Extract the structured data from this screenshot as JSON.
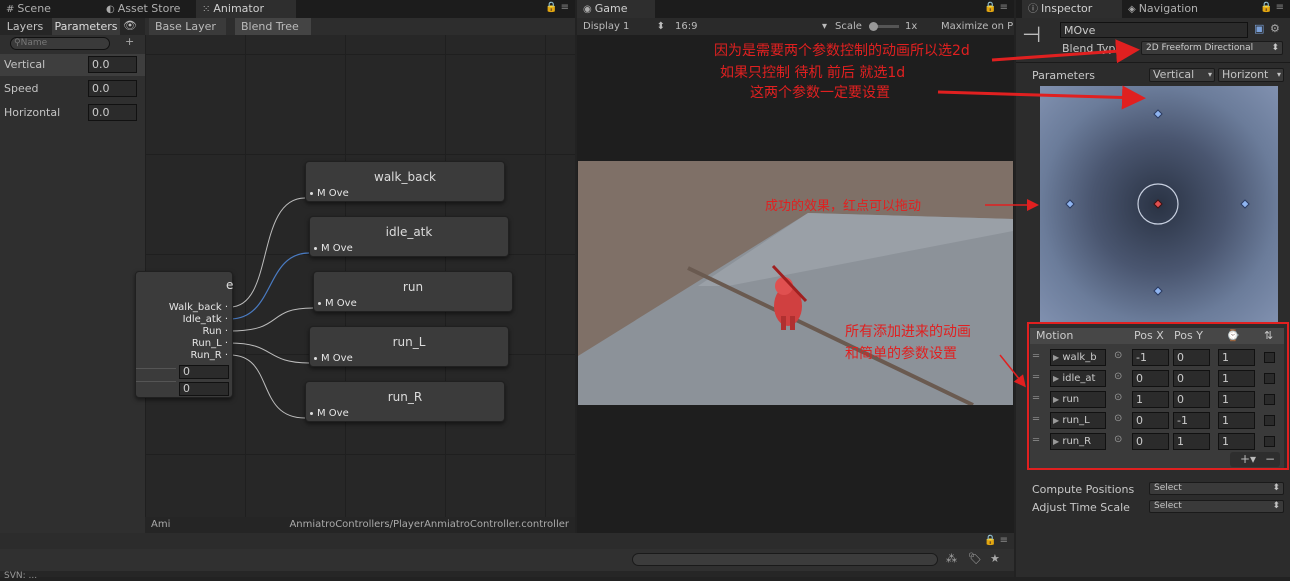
{
  "tabs": {
    "scene": "Scene",
    "asset_store": "Asset Store",
    "animator": "Animator",
    "game": "Game",
    "inspector": "Inspector",
    "navigation": "Navigation"
  },
  "animator": {
    "subtabs": {
      "layers": "Layers",
      "parameters": "Parameters"
    },
    "search_placeholder": "Name",
    "parameters": [
      {
        "name": "Vertical",
        "value": "0.0"
      },
      {
        "name": "Speed",
        "value": "0.0"
      },
      {
        "name": "Horizontal",
        "value": "0.0"
      }
    ],
    "breadcrumb": [
      "Base Layer",
      "Blend Tree"
    ],
    "blend_tree_node": {
      "title_fragment": "e",
      "outputs": [
        "Walk_back",
        "Idle_atk",
        "Run",
        "Run_L",
        "Run_R"
      ],
      "values": [
        "0",
        "0"
      ]
    },
    "motion_nodes": [
      {
        "title": "walk_back",
        "sub": "M Ove"
      },
      {
        "title": "idle_atk",
        "sub": "M Ove"
      },
      {
        "title": "run",
        "sub": "M Ove"
      },
      {
        "title": "run_L",
        "sub": "M Ove"
      },
      {
        "title": "run_R",
        "sub": "M Ove"
      }
    ],
    "footer_left": "Ami",
    "footer_path": "AnmiatroControllers/PlayerAnmiatroController.controller"
  },
  "game": {
    "display": "Display 1",
    "aspect": "16:9",
    "scale_label": "Scale",
    "scale_value": "1x",
    "maximize": "Maximize on P"
  },
  "inspector": {
    "name_value": "MOve",
    "blend_type_label": "Blend Type",
    "blend_type_value": "2D Freeform Directional",
    "parameters_label": "Parameters",
    "param_x": "Vertical",
    "param_y": "Horizont",
    "motion_header": {
      "motion": "Motion",
      "posx": "Pos X",
      "posy": "Pos Y"
    },
    "motions": [
      {
        "name": "walk_b",
        "x": "-1",
        "y": "0",
        "speed": "1"
      },
      {
        "name": "idle_at",
        "x": "0",
        "y": "0",
        "speed": "1"
      },
      {
        "name": "run",
        "x": "1",
        "y": "0",
        "speed": "1"
      },
      {
        "name": "run_L",
        "x": "0",
        "y": "-1",
        "speed": "1"
      },
      {
        "name": "run_R",
        "x": "0",
        "y": "1",
        "speed": "1"
      }
    ],
    "compute_positions_label": "Compute Positions",
    "compute_positions_value": "Select",
    "adjust_time_scale_label": "Adjust Time Scale",
    "adjust_time_scale_value": "Select"
  },
  "annotations": {
    "note1": "因为是需要两个参数控制的动画所以选2d",
    "note2": "如果只控制 待机 前后  就选1d",
    "note3": "这两个参数一定要设置",
    "note4": "成功的效果，红点可以拖动",
    "note5": "所有添加进来的动画",
    "note6": "和简单的参数设置"
  },
  "colors": {
    "annotation_red": "#e02020",
    "accent_blue": "#4a7bc2"
  },
  "console_text": "SVN: ... "
}
